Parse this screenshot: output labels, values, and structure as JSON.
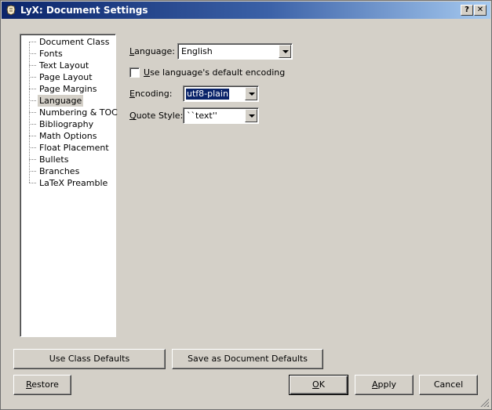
{
  "window": {
    "title": "LyX: Document Settings",
    "help_label": "?",
    "close_label": "✕"
  },
  "tree": {
    "items": [
      {
        "label": "Document Class",
        "selected": false
      },
      {
        "label": "Fonts",
        "selected": false
      },
      {
        "label": "Text Layout",
        "selected": false
      },
      {
        "label": "Page Layout",
        "selected": false
      },
      {
        "label": "Page Margins",
        "selected": false
      },
      {
        "label": "Language",
        "selected": true
      },
      {
        "label": "Numbering & TOC",
        "selected": false
      },
      {
        "label": "Bibliography",
        "selected": false
      },
      {
        "label": "Math Options",
        "selected": false
      },
      {
        "label": "Float Placement",
        "selected": false
      },
      {
        "label": "Bullets",
        "selected": false
      },
      {
        "label": "Branches",
        "selected": false
      },
      {
        "label": "LaTeX Preamble",
        "selected": false
      }
    ]
  },
  "language_panel": {
    "language_label_u": "L",
    "language_label_rest": "anguage:",
    "language_value": "English",
    "default_encoding_u": "U",
    "default_encoding_rest": "se language's default encoding",
    "default_encoding_checked": false,
    "encoding_label_u": "E",
    "encoding_label_rest": "ncoding:",
    "encoding_value": "utf8-plain",
    "quote_label_u": "Q",
    "quote_label_rest": "uote Style:",
    "quote_value": "``text''"
  },
  "buttons": {
    "use_class_defaults": "Use Class Defaults",
    "save_as_document_defaults": "Save as Document Defaults",
    "restore_u": "R",
    "restore_rest": "estore",
    "ok_u": "O",
    "ok_rest": "K",
    "apply_u": "A",
    "apply_rest": "pply",
    "cancel": "Cancel"
  },
  "colors": {
    "dialog_bg": "#d4d0c8",
    "titlebar_start": "#0a246a",
    "titlebar_end": "#a6caf0",
    "selection_bg": "#0a246a"
  }
}
